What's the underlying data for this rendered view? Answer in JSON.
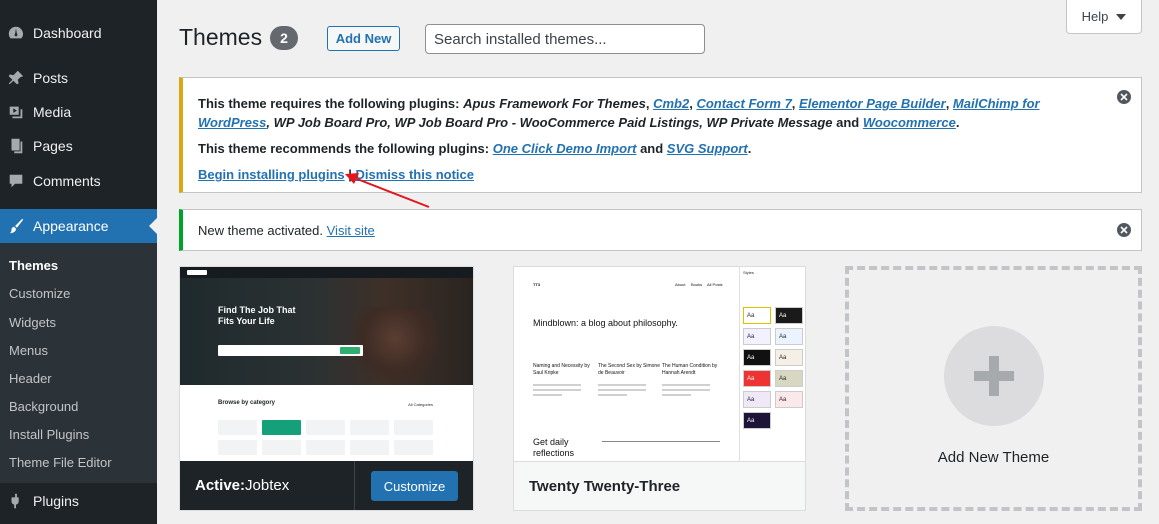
{
  "sidebar": {
    "items": [
      {
        "label": "Dashboard",
        "icon": "dashboard-icon"
      },
      {
        "label": "Posts",
        "icon": "pin-icon"
      },
      {
        "label": "Media",
        "icon": "media-icon"
      },
      {
        "label": "Pages",
        "icon": "pages-icon"
      },
      {
        "label": "Comments",
        "icon": "comment-icon"
      },
      {
        "label": "Appearance",
        "icon": "paintbrush-icon"
      },
      {
        "label": "Plugins",
        "icon": "plugin-icon"
      }
    ],
    "submenu": [
      "Themes",
      "Customize",
      "Widgets",
      "Menus",
      "Header",
      "Background",
      "Install Plugins",
      "Theme File Editor"
    ],
    "current_submenu": "Themes"
  },
  "header": {
    "title": "Themes",
    "count": "2",
    "add_new": "Add New",
    "search_placeholder": "Search installed themes...",
    "help": "Help"
  },
  "notice_plugins": {
    "line1_prefix": "This theme requires the following plugins: ",
    "req_apus": "Apus Framework For Themes",
    "sep": ", ",
    "req_cmb2": "Cmb2",
    "req_cf7": "Contact Form 7",
    "req_elementor": "Elementor Page Builder",
    "req_mailchimp_a": "MailChimp for",
    "req_mailchimp_b": "WordPress",
    "req_rest": ", WP Job Board Pro, WP Job Board Pro - WooCommerce Paid Listings, WP Private Message",
    "and": " and ",
    "req_woo": "Woocommerce",
    "period": ".",
    "line2_prefix": "This theme recommends the following plugins: ",
    "rec_ocdi": "One Click Demo Import",
    "rec_svg": "SVG Support",
    "begin_link": "Begin installing plugins",
    "pipe": " | ",
    "dismiss_link": "Dismiss this notice"
  },
  "notice_activated": {
    "text": "New theme activated. ",
    "link": "Visit site"
  },
  "themes": {
    "active_prefix": "Active:",
    "active_name": " Jobtex",
    "customize": "Customize",
    "second_name": "Twenty Twenty-Three",
    "add_new_theme": "Add New Theme"
  },
  "jobtex_preview": {
    "hero": "Find The Job That Fits Your Life",
    "browse": "Browse by category",
    "all": "All Categories"
  },
  "tt3_preview": {
    "site": "TT3",
    "nav": [
      "About",
      "Books",
      "All Posts"
    ],
    "headline": "Mindblown: a blog about philosophy.",
    "posts": [
      {
        "title": "Naming and Necessity by Saul Kripke"
      },
      {
        "title": "The Second Sex by Simone de Beauvoir"
      },
      {
        "title": "The Human Condition by Hannah Arendt"
      }
    ],
    "daily": "Get daily reflections",
    "panel_title": "Styles",
    "swatch": "Aa"
  },
  "colors": {
    "accent": "#2271b1",
    "sidebar": "#1d2327",
    "warning": "#dba617",
    "success": "#00a32a"
  }
}
